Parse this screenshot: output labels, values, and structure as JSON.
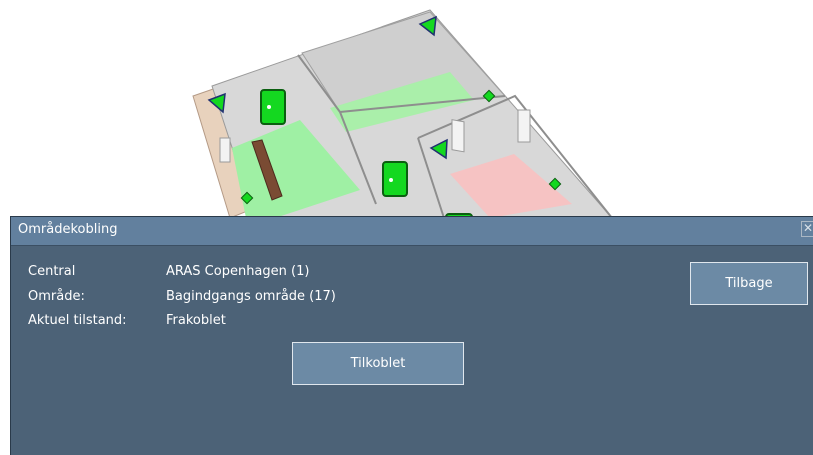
{
  "dialog": {
    "title": "Områdekobling",
    "close_icon": "close-icon",
    "fields": [
      {
        "label": "Central",
        "value": "ARAS Copenhagen (1)"
      },
      {
        "label": "Område:",
        "value": "Bagindgangs område (17)"
      },
      {
        "label": "Aktuel tilstand:",
        "value": "Frakoblet"
      }
    ],
    "connect_button": "Tilkoblet",
    "back_button": "Tilbage"
  },
  "colors": {
    "dialog_bg": "#4c6277",
    "titlebar_bg": "#62809e",
    "button_bg": "#6c8aa5",
    "zone_green": "#9ff0a4",
    "zone_red": "#f6c3c3",
    "device_green": "#14d820"
  },
  "floorplan": {
    "icons": [
      "camera-icon",
      "door-icon",
      "sensor-icon"
    ]
  }
}
